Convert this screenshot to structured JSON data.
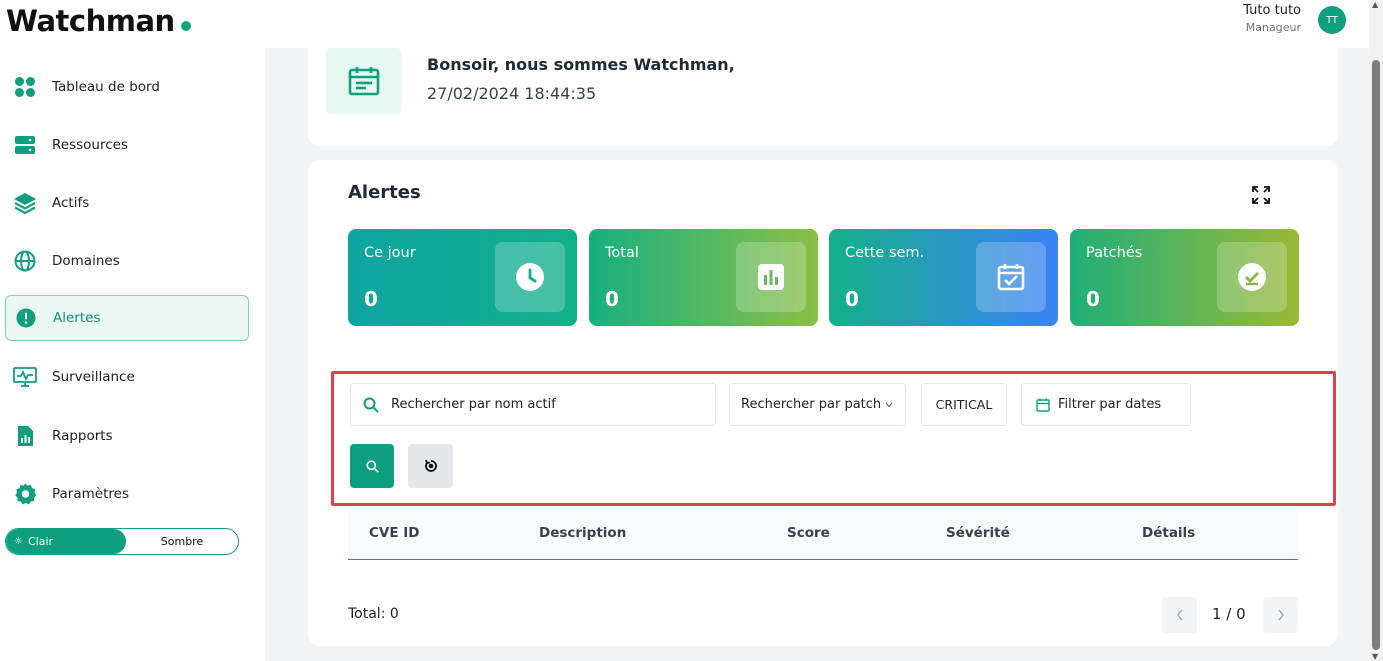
{
  "app": {
    "brand": "Watchman"
  },
  "user": {
    "name": "Tuto tuto",
    "role": "Manageur",
    "initials": "TT"
  },
  "sidebar": {
    "items": [
      {
        "label": "Tableau de bord",
        "icon": "dashboard-icon"
      },
      {
        "label": "Ressources",
        "icon": "server-icon"
      },
      {
        "label": "Actifs",
        "icon": "layers-icon"
      },
      {
        "label": "Domaines",
        "icon": "globe-icon"
      },
      {
        "label": "Alertes",
        "icon": "alert-icon",
        "active": true
      },
      {
        "label": "Surveillance",
        "icon": "monitor-icon"
      },
      {
        "label": "Rapports",
        "icon": "report-icon"
      },
      {
        "label": "Paramètres",
        "icon": "gear-icon"
      }
    ],
    "theme": {
      "light": "Clair",
      "dark": "Sombre",
      "selected": "Clair"
    }
  },
  "welcome": {
    "title": "Bonsoir, nous sommes Watchman,",
    "datetime": "27/02/2024 18:44:35"
  },
  "alerts": {
    "title": "Alertes",
    "stats": [
      {
        "label": "Ce jour",
        "value": "0",
        "icon": "clock-icon"
      },
      {
        "label": "Total",
        "value": "0",
        "icon": "bar-chart-icon"
      },
      {
        "label": "Cette sem.",
        "value": "0",
        "icon": "calendar-check-icon"
      },
      {
        "label": "Patchés",
        "value": "0",
        "icon": "check-circle-icon"
      }
    ],
    "filters": {
      "search_placeholder": "Rechercher par nom actif",
      "patch_select": "Rechercher par patch",
      "severity": "CRITICAL",
      "dates": "Filtrer par dates"
    },
    "table": {
      "columns": [
        "CVE ID",
        "Description",
        "Score",
        "Sévérité",
        "Détails"
      ],
      "rows": []
    },
    "footer": {
      "total": "Total: 0",
      "page": "1 / 0"
    }
  },
  "colors": {
    "accent": "#0e9f7e",
    "highlight": "#d9454b"
  }
}
